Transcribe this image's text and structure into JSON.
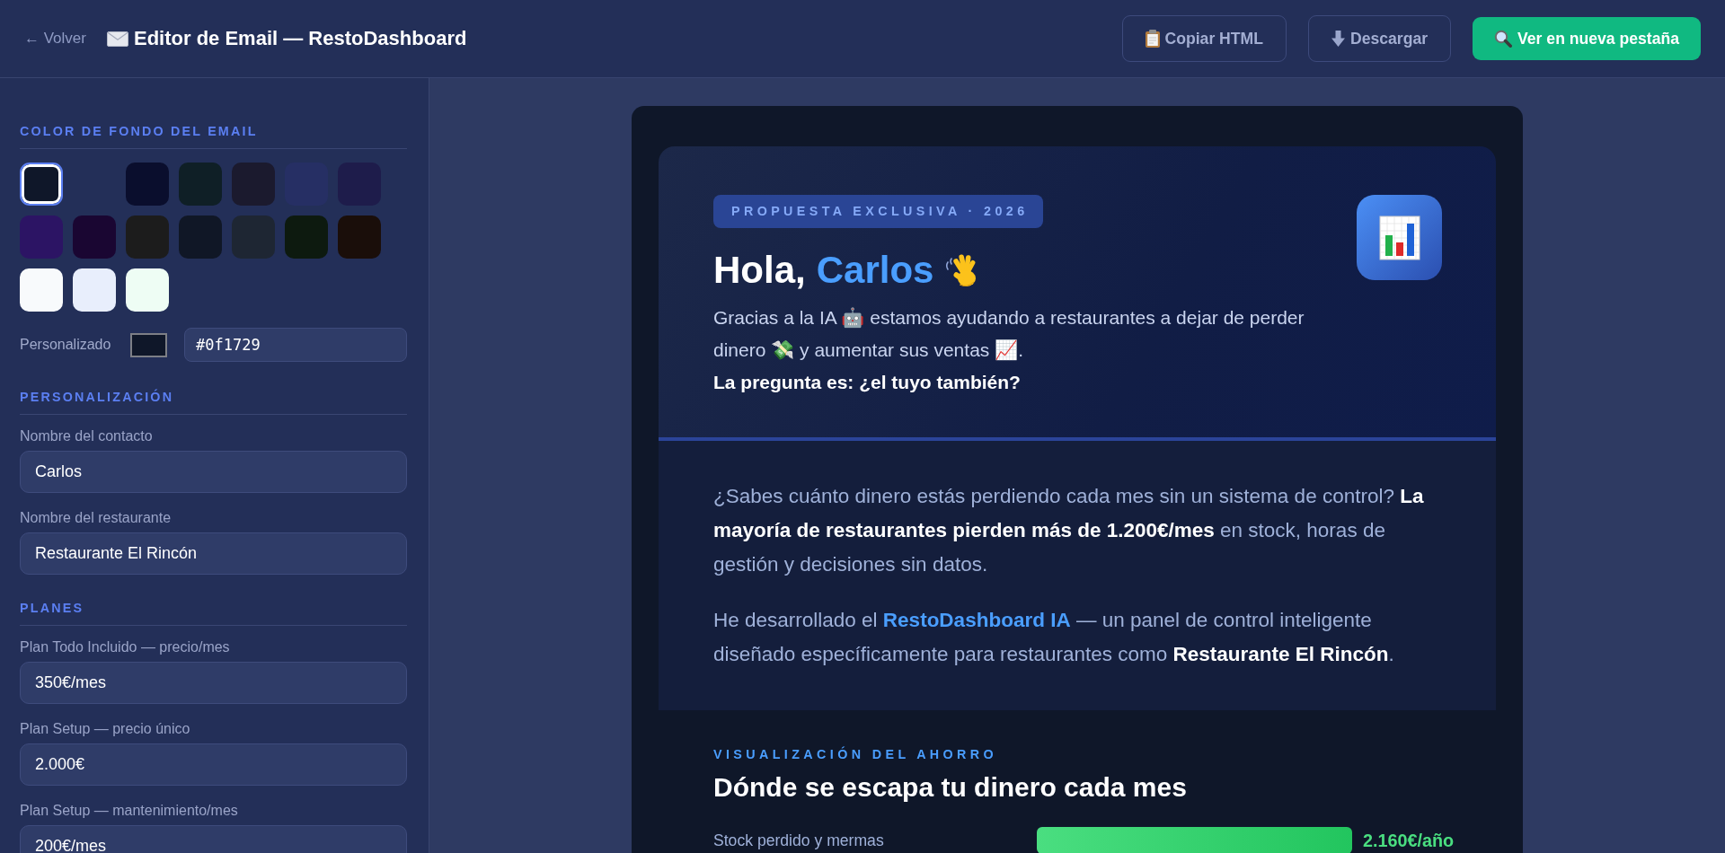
{
  "topbar": {
    "back_link": "← Volver",
    "title": "Editor de Email — RestoDashboard",
    "buttons": [
      {
        "label": "Copiar HTML",
        "kind": "outline"
      },
      {
        "label": "Descargar",
        "kind": "outline"
      },
      {
        "label": "Ver en nueva pestaña",
        "kind": "primary"
      }
    ]
  },
  "sidebar": {
    "background": {
      "title": "COLOR DE FONDO DEL EMAIL",
      "swatches": [
        {
          "color": "#0f1729",
          "selected": true
        },
        {
          "color": "#0a0e2d",
          "selected": false
        },
        {
          "color": "#0f1f26",
          "selected": false
        },
        {
          "color": "#1b1a2e",
          "selected": false
        },
        {
          "color": "#262f64",
          "selected": false
        },
        {
          "color": "#1e1c4b",
          "selected": false
        },
        {
          "color": "#2c1464",
          "selected": false
        },
        {
          "color": "#1a0632",
          "selected": false
        },
        {
          "color": "#1c1c1c",
          "selected": false
        },
        {
          "color": "#101726",
          "selected": false
        },
        {
          "color": "#1e2633",
          "selected": false
        },
        {
          "color": "#0d1a0f",
          "selected": false
        },
        {
          "color": "#1a0e0a",
          "selected": false
        },
        {
          "color": "#f8fafc",
          "selected": false
        },
        {
          "color": "#e8eefc",
          "selected": false
        },
        {
          "color": "#eefdf4",
          "selected": false
        }
      ],
      "custom_label": "Personalizado",
      "custom_value": "#0f1729"
    },
    "sections": [
      {
        "title": "PERSONALIZACIÓN",
        "fields": [
          {
            "label": "Nombre del contacto",
            "value": "Carlos"
          },
          {
            "label": "Nombre del restaurante",
            "value": "Restaurante El Rincón"
          }
        ]
      },
      {
        "title": "PLANES",
        "fields": [
          {
            "label": "Plan Todo Incluido — precio/mes",
            "value": "350€/mes"
          },
          {
            "label": "Plan Setup — precio único",
            "value": "2.000€"
          },
          {
            "label": "Plan Setup — mantenimiento/mes",
            "value": "200€/mes"
          }
        ]
      }
    ]
  },
  "email": {
    "header": {
      "badge": "PROPUESTA EXCLUSIVA · 2026",
      "greeting": "Hola,",
      "contact_name": "Carlos",
      "intro": "Gracias a la IA 🤖 estamos ayudando a restaurantes a dejar de perder dinero 💸 y aumentar sus ventas 📈.",
      "question": "La pregunta es: ¿el tuyo también?"
    },
    "body": {
      "paragraphs": [
        {
          "kind": "plain",
          "text": "¿Sabes cuánto dinero estás perdiendo cada mes sin un sistema de control? **La mayoría de restaurantes pierden más de 1.200€/mes** en stock, horas de gestión y decisiones sin datos."
        },
        {
          "kind": "product",
          "text": "He desarrollado el **RestoDashboard IA** — un panel de control inteligente diseñado específicamente para restaurantes como **Restaurante El Rincón**."
        }
      ]
    },
    "savings": {
      "eyebrow": "VISUALIZACIÓN DEL AHORRO",
      "title": "Dónde se escapa tu dinero cada mes",
      "rows": [
        {
          "label": "Stock perdido y mermas",
          "level": 1,
          "value": "2.160€/año"
        }
      ]
    }
  }
}
